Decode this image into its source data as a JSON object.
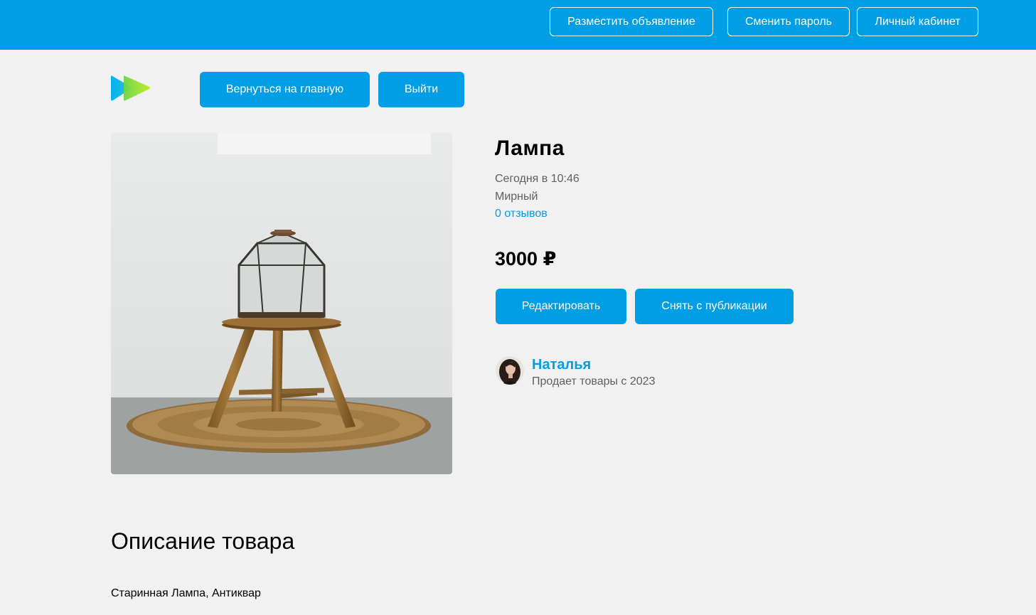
{
  "header": {
    "post_ad_label": "Разместить объявление",
    "change_password_label": "Сменить пароль",
    "account_label": "Личный кабинет"
  },
  "nav": {
    "home_label": "Вернуться на главную",
    "logout_label": "Выйти"
  },
  "product": {
    "title": "Лампа",
    "date": "Сегодня в 10:46",
    "city": "Мирный",
    "reviews": "0 отзывов",
    "price": "3000 ₽",
    "edit_label": "Редактировать",
    "unpublish_label": "Снять с публикации"
  },
  "seller": {
    "name": "Наталья",
    "since": "Продает товары с 2023"
  },
  "description": {
    "heading": "Описание товара",
    "text": "Старинная Лампа, Антиквар"
  },
  "colors": {
    "accent": "#009ee4",
    "background": "#f1f1f1",
    "muted_text": "#5f5f5f"
  },
  "icons": {
    "logo": "play-logo-icon"
  }
}
